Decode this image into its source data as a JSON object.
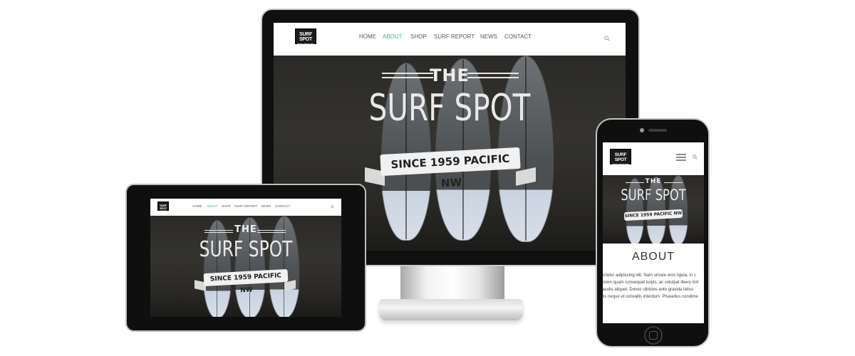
{
  "site": {
    "logo_line1": "SURF SPOT",
    "logo_line2": "SINCE 1959 PACIFIC NW",
    "nav": [
      {
        "label": "HOME",
        "active": false
      },
      {
        "label": "ABOUT",
        "active": true
      },
      {
        "label": "SHOP",
        "active": false
      },
      {
        "label": "SURF REPORT",
        "active": false
      },
      {
        "label": "NEWS",
        "active": false
      },
      {
        "label": "CONTACT",
        "active": false
      }
    ]
  },
  "hero": {
    "the": "THE",
    "title": "SURF SPOT",
    "ribbon": "SINCE 1959 PACIFIC NW"
  },
  "about": {
    "heading": "ABOUT",
    "lines": [
      "ectetur adipiscing elit. Nam ornare eros ligula, in c",
      "lorem quam consequat turpis, ac volutpat libero tort",
      "iaculis aliquet. Donec ultricies ante gravida tellus",
      "itis neque et convallis interdum. Phasellus condime"
    ]
  },
  "colors": {
    "accent": "#3fb59a",
    "nav_text": "#5a5a5a",
    "device_frame": "#0f0f0f"
  },
  "icons": {
    "search": "search-icon",
    "menu": "hamburger-menu-icon"
  }
}
